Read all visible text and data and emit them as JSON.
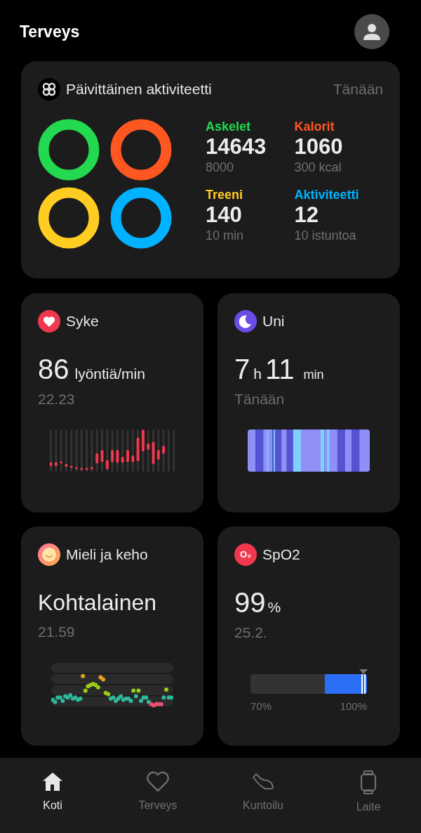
{
  "header": {
    "title": "Terveys"
  },
  "activity": {
    "title": "Päivittäinen aktiviteetti",
    "date": "Tänään",
    "metrics": [
      {
        "label": "Askelet",
        "value": "14643",
        "goal": "8000",
        "color": "#22d94f"
      },
      {
        "label": "Kalorit",
        "value": "1060",
        "goal": "300 kcal",
        "color": "#ff5722"
      },
      {
        "label": "Treeni",
        "value": "140",
        "goal": "10 min",
        "color": "#ffcc22"
      },
      {
        "label": "Aktiviteetti",
        "value": "12",
        "goal": "10 istuntoa",
        "color": "#00b2ff"
      }
    ]
  },
  "heart": {
    "title": "Syke",
    "value": "86",
    "unit": "lyöntiä/min",
    "time": "22.23"
  },
  "sleep": {
    "title": "Uni",
    "hours": "7",
    "hours_unit": "h",
    "minutes": "11",
    "minutes_unit": "min",
    "day": "Tänään"
  },
  "mind": {
    "title": "Mieli ja keho",
    "value": "Kohtalainen",
    "time": "21.59"
  },
  "spo2": {
    "title": "SpO2",
    "icon": "O₂",
    "value": "99",
    "unit": "%",
    "date": "25.2.",
    "min_label": "70%",
    "max_label": "100%"
  },
  "nav": [
    {
      "label": "Koti",
      "kind": "home",
      "selected": true
    },
    {
      "label": "Terveys",
      "kind": "heart",
      "selected": false
    },
    {
      "label": "Kuntoilu",
      "kind": "shoe",
      "selected": false
    },
    {
      "label": "Laite",
      "kind": "watch",
      "selected": false
    }
  ]
}
